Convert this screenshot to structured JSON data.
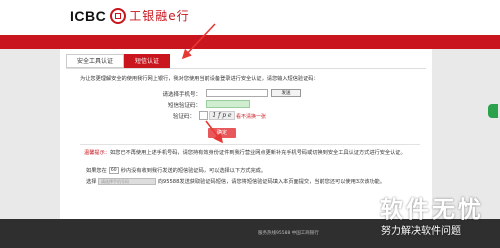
{
  "header": {
    "logo_en": "ICBC",
    "logo_cn": "工银融e行"
  },
  "tabs": [
    {
      "label": "安全工具认证"
    },
    {
      "label": "短信认证"
    }
  ],
  "form": {
    "intro": "为让您更理解安全的使用我行网上银行，我对您使用当前设备登录进行安全认证，请您输入短信验证码：",
    "phone_label": "请选择手机号：",
    "send_button": "发送",
    "sms_label": "短信验证码：",
    "captcha_label": "验证码：",
    "captcha_text": "1 f p e",
    "refresh_link": "看不清换一张",
    "confirm_button": "确定"
  },
  "tips": {
    "warning_prefix": "温馨提示：",
    "warning_text": "如您已不再使用上述手机号码，请您持有效身份证件到我行营业网点更新补充手机号码或切换到安全工具认证方式进行安全认证。",
    "countdown_prefix": "如果您在",
    "countdown_seconds": "60",
    "countdown_suffix": "秒内没有收到我行发送的短信验证码，可以选择以下方式完成。",
    "select_prefix": "选择",
    "select_placeholder": "请选择手机号码",
    "select_suffix": "向95588发送获取验证码短信，请您将短信验证码填入本页面提交，当前您还可以使用3次该功能。"
  },
  "footer": {
    "text": "服务热线95588    中国工商银行"
  },
  "watermark": {
    "line1": "软件无忧",
    "line2": "努力解决软件问题"
  },
  "colors": {
    "brand_red": "#c9151e",
    "confirm_button": "#e8585a",
    "annotation_red": "#e53935"
  }
}
